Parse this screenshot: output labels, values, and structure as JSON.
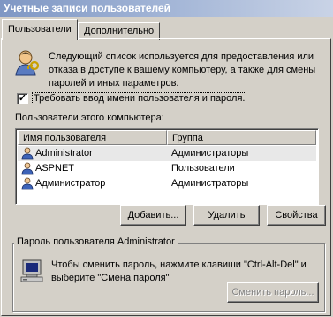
{
  "window": {
    "title": "Учетные записи пользователей"
  },
  "tabs": [
    {
      "label": "Пользователи"
    },
    {
      "label": "Дополнительно"
    }
  ],
  "info": {
    "text_line1": "Следующий список используется для предоставления или",
    "text_line2": "отказа в доступе к вашему компьютеру, а также для смены",
    "text_line3": "паролей и иных параметров."
  },
  "require_login": {
    "checked_mark": "✓",
    "label": "Требовать ввод имени пользователя и пароля."
  },
  "users_section": {
    "label": "Пользователи этого компьютера:",
    "columns": [
      "Имя пользователя",
      "Группа"
    ],
    "rows": [
      {
        "name": "Administrator",
        "group": "Администраторы"
      },
      {
        "name": "ASPNET",
        "group": "Пользователи"
      },
      {
        "name": "Администратор",
        "group": "Администраторы"
      }
    ]
  },
  "buttons": {
    "add": "Добавить...",
    "remove": "Удалить",
    "properties": "Свойства"
  },
  "password_group": {
    "legend": "Пароль пользователя Administrator",
    "text_line1": "Чтобы сменить пароль, нажмите клавиши \"Ctrl-Alt-Del\" и",
    "text_line2": "выберите \"Смена пароля\"",
    "change_button": "Сменить пароль..."
  }
}
